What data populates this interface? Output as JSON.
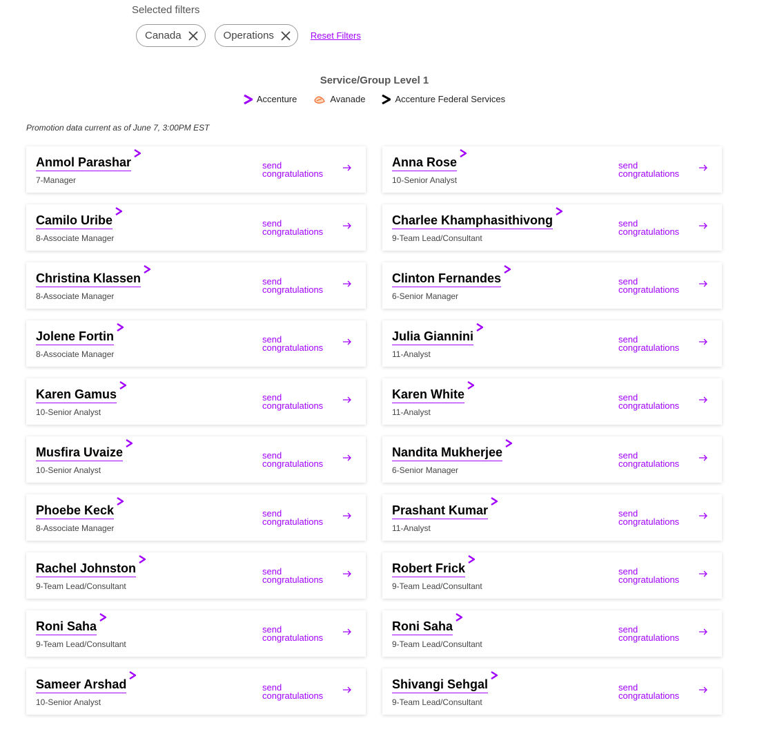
{
  "filters": {
    "label": "Selected filters",
    "chips": [
      "Canada",
      "Operations"
    ],
    "reset_label": "Reset Filters"
  },
  "legend": {
    "title": "Service/Group Level 1",
    "items": [
      {
        "label": "Accenture",
        "icon": "accenture-chevron-icon",
        "color": "#a100ff"
      },
      {
        "label": "Avanade",
        "icon": "avanade-icon",
        "color": "#f2672a"
      },
      {
        "label": "Accenture Federal Services",
        "icon": "afs-chevron-icon",
        "color": "#000000"
      }
    ]
  },
  "note": "Promotion data current as of June 7, 3:00PM EST",
  "congrats_line1": "send",
  "congrats_line2": "congratulations",
  "accent_color": "#a100ff",
  "people": [
    {
      "name": "Anmol Parashar",
      "level": "7-Manager"
    },
    {
      "name": "Anna Rose",
      "level": "10-Senior Analyst"
    },
    {
      "name": "Camilo Uribe",
      "level": "8-Associate Manager"
    },
    {
      "name": "Charlee Khamphasithivong",
      "level": "9-Team Lead/Consultant"
    },
    {
      "name": "Christina Klassen",
      "level": "8-Associate Manager"
    },
    {
      "name": "Clinton Fernandes",
      "level": "6-Senior Manager"
    },
    {
      "name": "Jolene Fortin",
      "level": "8-Associate Manager"
    },
    {
      "name": "Julia Giannini",
      "level": "11-Analyst"
    },
    {
      "name": "Karen Gamus",
      "level": "10-Senior Analyst"
    },
    {
      "name": "Karen White",
      "level": "11-Analyst"
    },
    {
      "name": "Musfira Uvaize",
      "level": "10-Senior Analyst"
    },
    {
      "name": "Nandita Mukherjee",
      "level": "6-Senior Manager"
    },
    {
      "name": "Phoebe Keck",
      "level": "8-Associate Manager"
    },
    {
      "name": "Prashant Kumar",
      "level": "11-Analyst"
    },
    {
      "name": "Rachel Johnston",
      "level": "9-Team Lead/Consultant"
    },
    {
      "name": "Robert Frick",
      "level": "9-Team Lead/Consultant"
    },
    {
      "name": "Roni Saha",
      "level": "9-Team Lead/Consultant"
    },
    {
      "name": "Roni Saha",
      "level": "9-Team Lead/Consultant"
    },
    {
      "name": "Sameer Arshad",
      "level": "10-Senior Analyst"
    },
    {
      "name": "Shivangi Sehgal",
      "level": "9-Team Lead/Consultant"
    }
  ]
}
